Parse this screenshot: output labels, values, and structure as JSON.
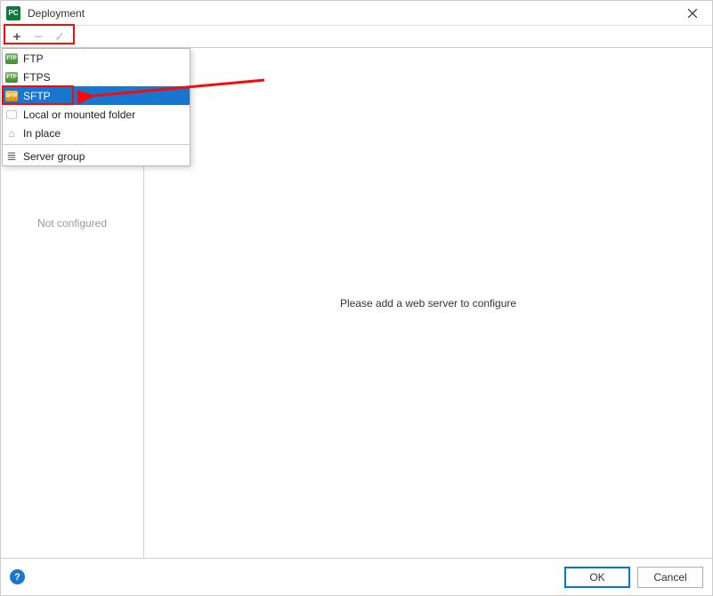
{
  "window": {
    "title": "Deployment",
    "app_icon_label": "PC"
  },
  "toolbar": {
    "add": "+",
    "remove": "−",
    "apply": "✓"
  },
  "dropdown": {
    "items": [
      {
        "label": "FTP",
        "icon": "ftp"
      },
      {
        "label": "FTPS",
        "icon": "ftp"
      },
      {
        "label": "SFTP",
        "icon": "sftp",
        "selected": true
      },
      {
        "label": "Local or mounted folder",
        "icon": "folder"
      },
      {
        "label": "In place",
        "icon": "home"
      }
    ],
    "group_label": "Server group"
  },
  "sidebar": {
    "placeholder": "Not configured"
  },
  "main": {
    "message": "Please add a web server to configure"
  },
  "footer": {
    "ok": "OK",
    "cancel": "Cancel",
    "help": "?"
  }
}
